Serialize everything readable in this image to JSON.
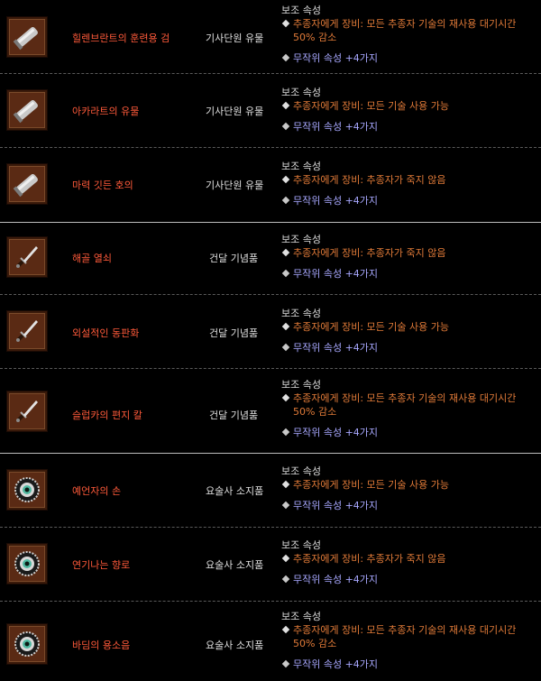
{
  "items": [
    {
      "name": "힐렌브란트의 훈련용 검",
      "type": "기사단원 유물",
      "icon": "sword-icon",
      "option_title": "보조 속성",
      "option_lines": [
        "추종자에게 장비: 모든 추종자 기술의 재사용 대기시간",
        "50% 감소"
      ],
      "random": "무작위 속성 +4가지"
    },
    {
      "name": "아카라트의 유물",
      "type": "기사단원 유물",
      "icon": "sword-icon",
      "option_title": "보조 속성",
      "option_lines": [
        "추종자에게 장비: 모든 기술 사용 가능"
      ],
      "random": "무작위 속성 +4가지"
    },
    {
      "name": "마력 깃든 호의",
      "type": "기사단원 유물",
      "icon": "sword-icon",
      "option_title": "보조 속성",
      "option_lines": [
        "추종자에게 장비: 추종자가 죽지 않음"
      ],
      "random": "무작위 속성 +4가지"
    },
    {
      "name": "해골 열쇠",
      "type": "건달 기념품",
      "icon": "dagger-icon",
      "option_title": "보조 속성",
      "option_lines": [
        "추종자에게 장비: 추종자가 죽지 않음"
      ],
      "random": "무작위 속성 +4가지"
    },
    {
      "name": "외설적인 동판화",
      "type": "건달 기념품",
      "icon": "dagger-icon",
      "option_title": "보조 속성",
      "option_lines": [
        "추종자에게 장비: 모든 기술 사용 가능"
      ],
      "random": "무작위 속성 +4가지"
    },
    {
      "name": "슬럽카의 편지 칼",
      "type": "건달 기념품",
      "icon": "dagger-icon",
      "option_title": "보조 속성",
      "option_lines": [
        "추종자에게 장비: 모든 추종자 기술의 재사용 대기시간",
        "50% 감소"
      ],
      "random": "무작위 속성 +4가지"
    },
    {
      "name": "예언자의 손",
      "type": "요술사 소지품",
      "icon": "eye-orb-icon",
      "option_title": "보조 속성",
      "option_lines": [
        "추종자에게 장비: 모든 기술 사용 가능"
      ],
      "random": "무작위 속성 +4가지"
    },
    {
      "name": "연기나는 향로",
      "type": "요술사 소지품",
      "icon": "eye-orb-icon",
      "option_title": "보조 속성",
      "option_lines": [
        "추종자에게 장비: 추종자가 죽지 않음"
      ],
      "random": "무작위 속성 +4가지"
    },
    {
      "name": "바딤의 용소음",
      "type": "요술사 소지품",
      "icon": "eye-orb-icon",
      "option_title": "보조 속성",
      "option_lines": [
        "추종자에게 장비: 모든 추종자 기술의 재사용 대기시간",
        "50% 감소"
      ],
      "random": "무작위 속성 +4가지"
    }
  ]
}
